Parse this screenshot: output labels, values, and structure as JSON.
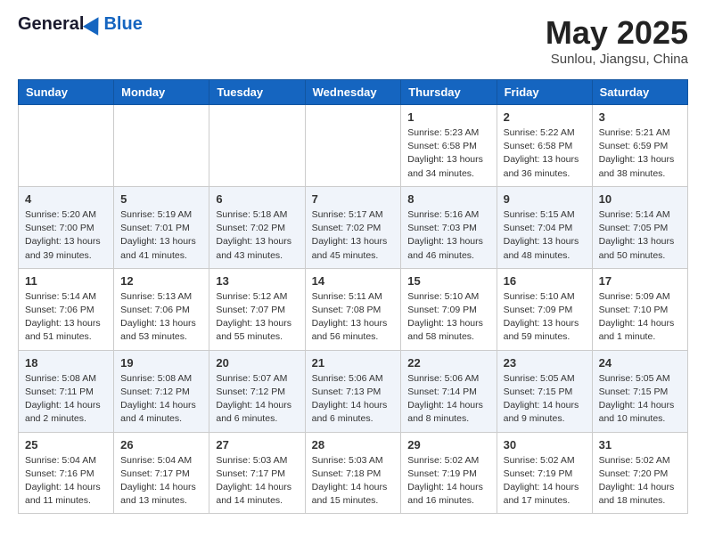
{
  "header": {
    "logo_general": "General",
    "logo_blue": "Blue",
    "title": "May 2025",
    "location": "Sunlou, Jiangsu, China"
  },
  "days_of_week": [
    "Sunday",
    "Monday",
    "Tuesday",
    "Wednesday",
    "Thursday",
    "Friday",
    "Saturday"
  ],
  "weeks": [
    [
      {
        "day": "",
        "content": ""
      },
      {
        "day": "",
        "content": ""
      },
      {
        "day": "",
        "content": ""
      },
      {
        "day": "",
        "content": ""
      },
      {
        "day": "1",
        "content": "Sunrise: 5:23 AM\nSunset: 6:58 PM\nDaylight: 13 hours\nand 34 minutes."
      },
      {
        "day": "2",
        "content": "Sunrise: 5:22 AM\nSunset: 6:58 PM\nDaylight: 13 hours\nand 36 minutes."
      },
      {
        "day": "3",
        "content": "Sunrise: 5:21 AM\nSunset: 6:59 PM\nDaylight: 13 hours\nand 38 minutes."
      }
    ],
    [
      {
        "day": "4",
        "content": "Sunrise: 5:20 AM\nSunset: 7:00 PM\nDaylight: 13 hours\nand 39 minutes."
      },
      {
        "day": "5",
        "content": "Sunrise: 5:19 AM\nSunset: 7:01 PM\nDaylight: 13 hours\nand 41 minutes."
      },
      {
        "day": "6",
        "content": "Sunrise: 5:18 AM\nSunset: 7:02 PM\nDaylight: 13 hours\nand 43 minutes."
      },
      {
        "day": "7",
        "content": "Sunrise: 5:17 AM\nSunset: 7:02 PM\nDaylight: 13 hours\nand 45 minutes."
      },
      {
        "day": "8",
        "content": "Sunrise: 5:16 AM\nSunset: 7:03 PM\nDaylight: 13 hours\nand 46 minutes."
      },
      {
        "day": "9",
        "content": "Sunrise: 5:15 AM\nSunset: 7:04 PM\nDaylight: 13 hours\nand 48 minutes."
      },
      {
        "day": "10",
        "content": "Sunrise: 5:14 AM\nSunset: 7:05 PM\nDaylight: 13 hours\nand 50 minutes."
      }
    ],
    [
      {
        "day": "11",
        "content": "Sunrise: 5:14 AM\nSunset: 7:06 PM\nDaylight: 13 hours\nand 51 minutes."
      },
      {
        "day": "12",
        "content": "Sunrise: 5:13 AM\nSunset: 7:06 PM\nDaylight: 13 hours\nand 53 minutes."
      },
      {
        "day": "13",
        "content": "Sunrise: 5:12 AM\nSunset: 7:07 PM\nDaylight: 13 hours\nand 55 minutes."
      },
      {
        "day": "14",
        "content": "Sunrise: 5:11 AM\nSunset: 7:08 PM\nDaylight: 13 hours\nand 56 minutes."
      },
      {
        "day": "15",
        "content": "Sunrise: 5:10 AM\nSunset: 7:09 PM\nDaylight: 13 hours\nand 58 minutes."
      },
      {
        "day": "16",
        "content": "Sunrise: 5:10 AM\nSunset: 7:09 PM\nDaylight: 13 hours\nand 59 minutes."
      },
      {
        "day": "17",
        "content": "Sunrise: 5:09 AM\nSunset: 7:10 PM\nDaylight: 14 hours\nand 1 minute."
      }
    ],
    [
      {
        "day": "18",
        "content": "Sunrise: 5:08 AM\nSunset: 7:11 PM\nDaylight: 14 hours\nand 2 minutes."
      },
      {
        "day": "19",
        "content": "Sunrise: 5:08 AM\nSunset: 7:12 PM\nDaylight: 14 hours\nand 4 minutes."
      },
      {
        "day": "20",
        "content": "Sunrise: 5:07 AM\nSunset: 7:12 PM\nDaylight: 14 hours\nand 6 minutes."
      },
      {
        "day": "21",
        "content": "Sunrise: 5:06 AM\nSunset: 7:13 PM\nDaylight: 14 hours\nand 6 minutes."
      },
      {
        "day": "22",
        "content": "Sunrise: 5:06 AM\nSunset: 7:14 PM\nDaylight: 14 hours\nand 8 minutes."
      },
      {
        "day": "23",
        "content": "Sunrise: 5:05 AM\nSunset: 7:15 PM\nDaylight: 14 hours\nand 9 minutes."
      },
      {
        "day": "24",
        "content": "Sunrise: 5:05 AM\nSunset: 7:15 PM\nDaylight: 14 hours\nand 10 minutes."
      }
    ],
    [
      {
        "day": "25",
        "content": "Sunrise: 5:04 AM\nSunset: 7:16 PM\nDaylight: 14 hours\nand 11 minutes."
      },
      {
        "day": "26",
        "content": "Sunrise: 5:04 AM\nSunset: 7:17 PM\nDaylight: 14 hours\nand 13 minutes."
      },
      {
        "day": "27",
        "content": "Sunrise: 5:03 AM\nSunset: 7:17 PM\nDaylight: 14 hours\nand 14 minutes."
      },
      {
        "day": "28",
        "content": "Sunrise: 5:03 AM\nSunset: 7:18 PM\nDaylight: 14 hours\nand 15 minutes."
      },
      {
        "day": "29",
        "content": "Sunrise: 5:02 AM\nSunset: 7:19 PM\nDaylight: 14 hours\nand 16 minutes."
      },
      {
        "day": "30",
        "content": "Sunrise: 5:02 AM\nSunset: 7:19 PM\nDaylight: 14 hours\nand 17 minutes."
      },
      {
        "day": "31",
        "content": "Sunrise: 5:02 AM\nSunset: 7:20 PM\nDaylight: 14 hours\nand 18 minutes."
      }
    ]
  ]
}
